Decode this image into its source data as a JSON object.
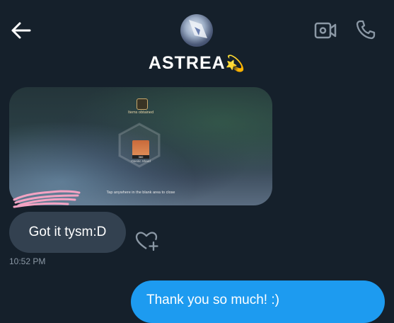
{
  "header": {
    "contact_name": "ASTREA",
    "name_emoji": "💫",
    "icons": [
      "back-arrow-icon",
      "video-call-icon",
      "phone-call-icon"
    ]
  },
  "media": {
    "items_obtained": "Items obtained",
    "item_count": "360",
    "item_name": "Oneiric Shard",
    "close_hint": "Tap anywhere in the blank area to close"
  },
  "messages": {
    "received_text": "Got it tysm:D",
    "received_time": "10:52 PM",
    "sent_text": "Thank you so much! :)"
  },
  "colors": {
    "background": "#15202b",
    "received_bubble": "#334150",
    "sent_bubble": "#1d9bf0",
    "scribble": "#f4a3c3"
  }
}
